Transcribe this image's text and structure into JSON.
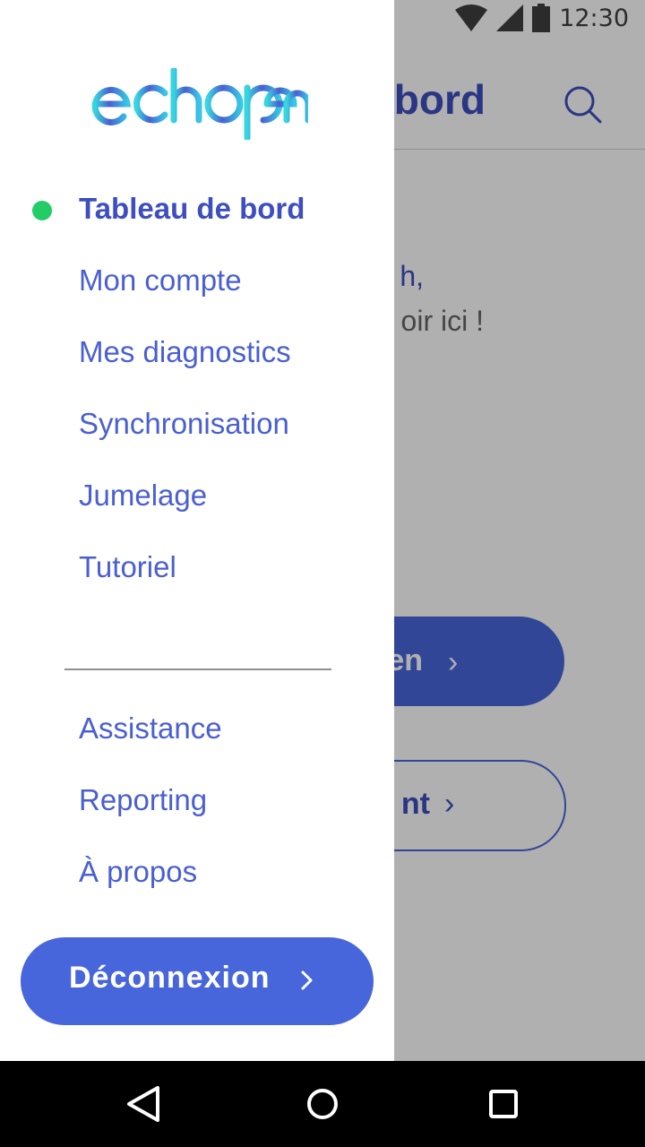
{
  "status_bar": {
    "time": "12:30",
    "icons": [
      "wifi-icon",
      "signal-icon",
      "battery-icon"
    ]
  },
  "background": {
    "title_fragment": "bord",
    "greeting_fragment": "h,",
    "greeting_line2_fragment": "oir ici !",
    "primary_button_fragment": "en",
    "outline_button_fragment": "nt"
  },
  "drawer": {
    "logo_text": "echopen",
    "menu": [
      {
        "label": "Tableau de bord",
        "active": true
      },
      {
        "label": "Mon compte"
      },
      {
        "label": "Mes diagnostics"
      },
      {
        "label": "Synchronisation"
      },
      {
        "label": "Jumelage"
      },
      {
        "label": "Tutoriel"
      }
    ],
    "secondary_menu": [
      {
        "label": "Assistance"
      },
      {
        "label": "Reporting"
      },
      {
        "label": "À propos"
      }
    ],
    "logout_label": "Déconnexion"
  },
  "colors": {
    "brand_blue": "#4866db",
    "active_dot": "#22cc66",
    "logo_cyan": "#36d6e0"
  }
}
